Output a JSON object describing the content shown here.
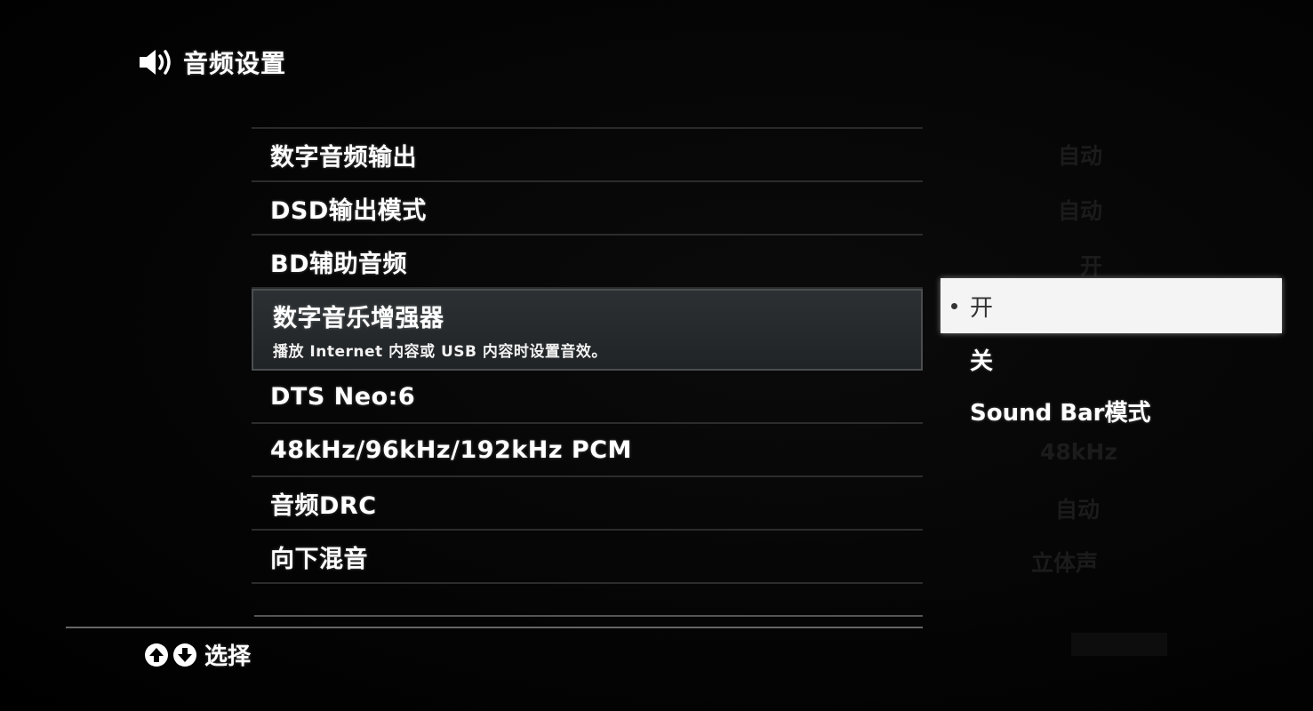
{
  "header": {
    "title": "音频设置",
    "icon": "speaker-icon"
  },
  "menu": {
    "items": [
      {
        "label": "数字音频输出",
        "value": "自动"
      },
      {
        "label": "DSD输出模式",
        "value": "自动"
      },
      {
        "label": "BD辅助音频",
        "value": "开"
      },
      {
        "label": "数字音乐增强器",
        "description": "播放 Internet 内容或 USB 内容时设置音效。",
        "selected": true
      },
      {
        "label": "DTS Neo:6"
      },
      {
        "label": "48kHz/96kHz/192kHz PCM",
        "value": "48kHz"
      },
      {
        "label": "音频DRC",
        "value": "自动"
      },
      {
        "label": "向下混音",
        "value": "立体声"
      }
    ]
  },
  "options": {
    "items": [
      {
        "label": "开",
        "active": true
      },
      {
        "label": "关"
      },
      {
        "label": "Sound Bar模式"
      }
    ]
  },
  "footer": {
    "hint": "选择",
    "icons": [
      "arrow-up-icon",
      "arrow-down-icon"
    ]
  },
  "colors": {
    "background": "#000000",
    "selected_row": "#2a2e30",
    "option_highlight": "#f4f4f4",
    "text": "#ffffff"
  }
}
